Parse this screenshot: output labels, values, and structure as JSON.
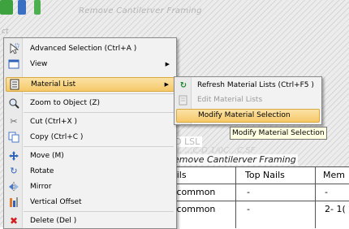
{
  "background": {
    "title": "Remove Cantilerver Framing",
    "left_label": "ct",
    "lsl_label": "D LSL",
    "faint_text": "2… …C-D 1/0C…C.SF",
    "drawing_header": "emove Cantilerver Framing",
    "table": {
      "headers": [
        "ails",
        "Top Nails",
        "Mem"
      ],
      "rows": [
        [
          "d common",
          "-",
          "-"
        ],
        [
          "d common",
          "-",
          "2- 1("
        ]
      ]
    }
  },
  "context_menu": {
    "items": [
      {
        "label": "Advanced Selection (Ctrl+A )",
        "icon": "cursor-select-icon"
      },
      {
        "label": "View",
        "icon": "window-icon",
        "has_submenu": true
      },
      {
        "label": "Material List",
        "icon": "list-icon",
        "has_submenu": true,
        "highlighted": true
      },
      {
        "label": "Zoom to Object (Z)",
        "icon": "zoom-icon"
      },
      {
        "label": "Cut (Ctrl+X )",
        "icon": "scissors-icon"
      },
      {
        "label": "Copy (Ctrl+C )",
        "icon": "copy-icon"
      },
      {
        "label": "Move (M)",
        "icon": "move-icon"
      },
      {
        "label": "Rotate",
        "icon": "rotate-icon"
      },
      {
        "label": "Mirror",
        "icon": "mirror-icon"
      },
      {
        "label": "Vertical Offset",
        "icon": "vertical-offset-icon"
      },
      {
        "label": "Delete (Del )",
        "icon": "delete-icon"
      }
    ]
  },
  "submenu": {
    "items": [
      {
        "label": "Refresh Material Lists (Ctrl+F5 )",
        "icon": "refresh-icon"
      },
      {
        "label": "Edit Material Lists",
        "icon": "edit-list-icon",
        "disabled": true
      },
      {
        "label": "Modify Material Selection",
        "highlighted": true
      }
    ]
  },
  "tooltip": {
    "text": "Modify Material Selection"
  },
  "colors": {
    "highlight": "#f6c969",
    "highlight_border": "#d8a93c",
    "menu_bg": "#f2f2f2",
    "tooltip_bg": "#ffffe1"
  }
}
